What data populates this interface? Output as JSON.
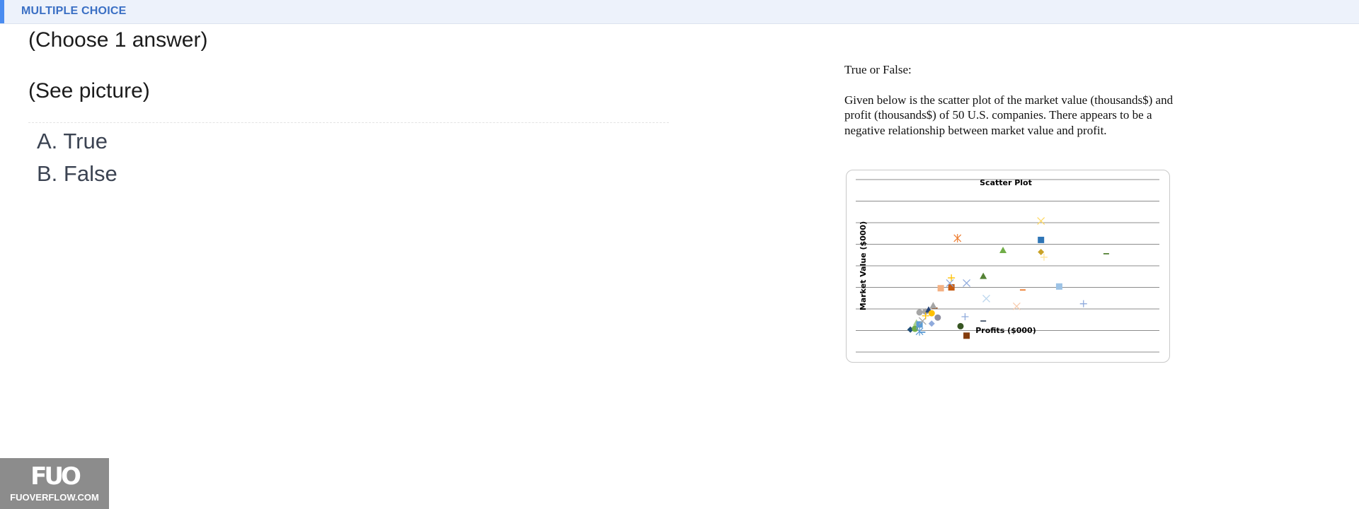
{
  "header": {
    "title": "MULTIPLE CHOICE"
  },
  "question": {
    "prompt_lines": [
      "(Choose 1 answer)",
      "(See picture)"
    ],
    "choices": [
      "A. True",
      "B. False"
    ]
  },
  "picture": {
    "paragraphs": [
      "True or False:",
      "Given below is the scatter plot of the market value (thousands$) and profit (thousands$) of 50 U.S. companies. There appears to be a negative relationship between market value and profit."
    ]
  },
  "chart_data": {
    "type": "scatter",
    "title": "Scatter Plot",
    "xlabel": "Profits ($000)",
    "ylabel": "Market Value ($000)",
    "grid": true,
    "x_ticks_shown": false,
    "y_ticks_shown": false,
    "note": "points estimated in relative units (0-100 range on each axis)",
    "points": [
      {
        "x": 18,
        "y": 13,
        "marker": "diamond",
        "color": "#1f4e79"
      },
      {
        "x": 19.5,
        "y": 13.5,
        "marker": "circle",
        "color": "#70ad47"
      },
      {
        "x": 21,
        "y": 12,
        "marker": "star",
        "color": "#5b9bd5"
      },
      {
        "x": 20,
        "y": 17,
        "marker": "triangle",
        "color": "#a9d18e"
      },
      {
        "x": 21,
        "y": 16,
        "marker": "square",
        "color": "#5b9bd5"
      },
      {
        "x": 22,
        "y": 18,
        "marker": "x",
        "color": "#a5a5a5"
      },
      {
        "x": 21,
        "y": 23,
        "marker": "circle",
        "color": "#a5a5a5"
      },
      {
        "x": 23,
        "y": 23.5,
        "marker": "circle",
        "color": "#a5a5a5"
      },
      {
        "x": 24,
        "y": 24.5,
        "marker": "triangle",
        "color": "#264478"
      },
      {
        "x": 25,
        "y": 22.5,
        "marker": "circle",
        "color": "#ffc000"
      },
      {
        "x": 26,
        "y": 25.5,
        "marker": "dash",
        "color": "#9e480e"
      },
      {
        "x": 25.5,
        "y": 27,
        "marker": "triangle",
        "color": "#a5a5a5"
      },
      {
        "x": 23,
        "y": 21,
        "marker": "plus",
        "color": "#ffc000"
      },
      {
        "x": 27,
        "y": 20,
        "marker": "circle",
        "color": "#8e8e9e"
      },
      {
        "x": 25,
        "y": 16.5,
        "marker": "diamond",
        "color": "#8faadc"
      },
      {
        "x": 22,
        "y": 11.5,
        "marker": "dash",
        "color": "#5b9bd5"
      },
      {
        "x": 28,
        "y": 37,
        "marker": "square",
        "color": "#f4b183"
      },
      {
        "x": 31.5,
        "y": 37.5,
        "marker": "square",
        "color": "#c55a11"
      },
      {
        "x": 31.5,
        "y": 43,
        "marker": "plus",
        "color": "#ffc000"
      },
      {
        "x": 31,
        "y": 40,
        "marker": "x",
        "color": "#8faadc"
      },
      {
        "x": 36.5,
        "y": 40,
        "marker": "x",
        "color": "#8faadc"
      },
      {
        "x": 33.5,
        "y": 66,
        "marker": "star",
        "color": "#ed7d31"
      },
      {
        "x": 36,
        "y": 20.5,
        "marker": "plus",
        "color": "#8faadc"
      },
      {
        "x": 34.5,
        "y": 15,
        "marker": "circle",
        "color": "#375623"
      },
      {
        "x": 36.5,
        "y": 9.5,
        "marker": "square",
        "color": "#843c0c"
      },
      {
        "x": 42,
        "y": 18,
        "marker": "dash",
        "color": "#44546a"
      },
      {
        "x": 43,
        "y": 31,
        "marker": "x",
        "color": "#bdd7ee"
      },
      {
        "x": 42,
        "y": 44,
        "marker": "triangle",
        "color": "#548235"
      },
      {
        "x": 48.5,
        "y": 59,
        "marker": "triangle",
        "color": "#70ad47"
      },
      {
        "x": 55,
        "y": 36,
        "marker": "dash",
        "color": "#ed7d31"
      },
      {
        "x": 53,
        "y": 26.5,
        "marker": "x",
        "color": "#f8cbad"
      },
      {
        "x": 61,
        "y": 76,
        "marker": "x",
        "color": "#ffd966"
      },
      {
        "x": 61,
        "y": 65,
        "marker": "square",
        "color": "#2e75b6"
      },
      {
        "x": 61,
        "y": 58,
        "marker": "diamond",
        "color": "#c9a227"
      },
      {
        "x": 62,
        "y": 55,
        "marker": "plus",
        "color": "#ffe699"
      },
      {
        "x": 67,
        "y": 38,
        "marker": "square",
        "color": "#9dc3e6"
      },
      {
        "x": 75,
        "y": 28,
        "marker": "plus",
        "color": "#8faadc"
      },
      {
        "x": 82.5,
        "y": 57,
        "marker": "dash",
        "color": "#548235"
      }
    ]
  }
}
